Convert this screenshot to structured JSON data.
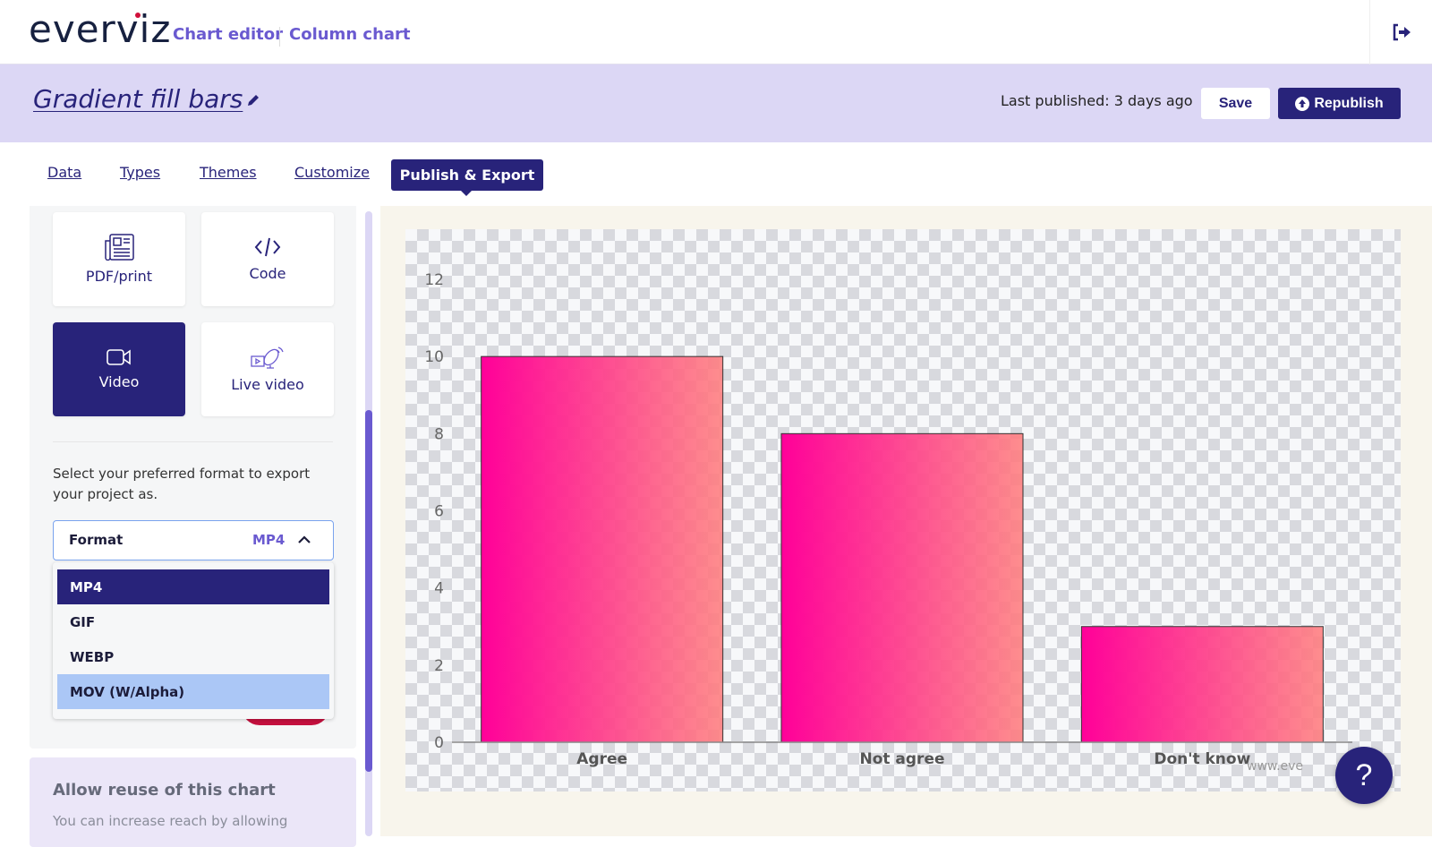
{
  "header": {
    "logo": "everviz",
    "breadcrumb": [
      "Chart editor",
      "Column chart"
    ],
    "logout_icon": "sign-out-icon"
  },
  "titlebar": {
    "title": "Gradient fill bars",
    "edit_icon": "pencil-icon",
    "last_published": "Last published: 3 days ago",
    "save_label": "Save",
    "republish_label": "Republish"
  },
  "tabs": [
    {
      "label": "Data"
    },
    {
      "label": "Types"
    },
    {
      "label": "Themes"
    },
    {
      "label": "Customize"
    },
    {
      "label": "Publish & Export",
      "active": true
    }
  ],
  "export_options": [
    {
      "label": "PDF/print",
      "icon": "newspaper-icon"
    },
    {
      "label": "Code",
      "icon": "code-icon"
    },
    {
      "label": "Video",
      "icon": "video-camera-icon",
      "active": true
    },
    {
      "label": "Live video",
      "icon": "satellite-dish-icon"
    }
  ],
  "format": {
    "help_text": "Select your preferred format to export your project as.",
    "label": "Format",
    "value": "MP4",
    "options": [
      "MP4",
      "GIF",
      "WEBP",
      "MOV (W/Alpha)"
    ],
    "selected": "MP4",
    "hovered": "MOV (W/Alpha)"
  },
  "reuse": {
    "title": "Allow reuse of this chart",
    "text": "You can increase reach by allowing"
  },
  "help_label": "?",
  "colors": {
    "primary": "#28237a",
    "accent": "#6a5ad0",
    "gradient_start": "#ff0099",
    "gradient_end": "#ff7f7f"
  },
  "chart_data": {
    "type": "bar",
    "categories": [
      "Agree",
      "Not agree",
      "Don't know"
    ],
    "values": [
      10,
      8,
      3
    ],
    "ylim": [
      0,
      12
    ],
    "yticks": [
      0,
      2,
      4,
      6,
      8,
      10,
      12
    ],
    "credits": "www.eve",
    "grid": false,
    "background": "transparent"
  }
}
